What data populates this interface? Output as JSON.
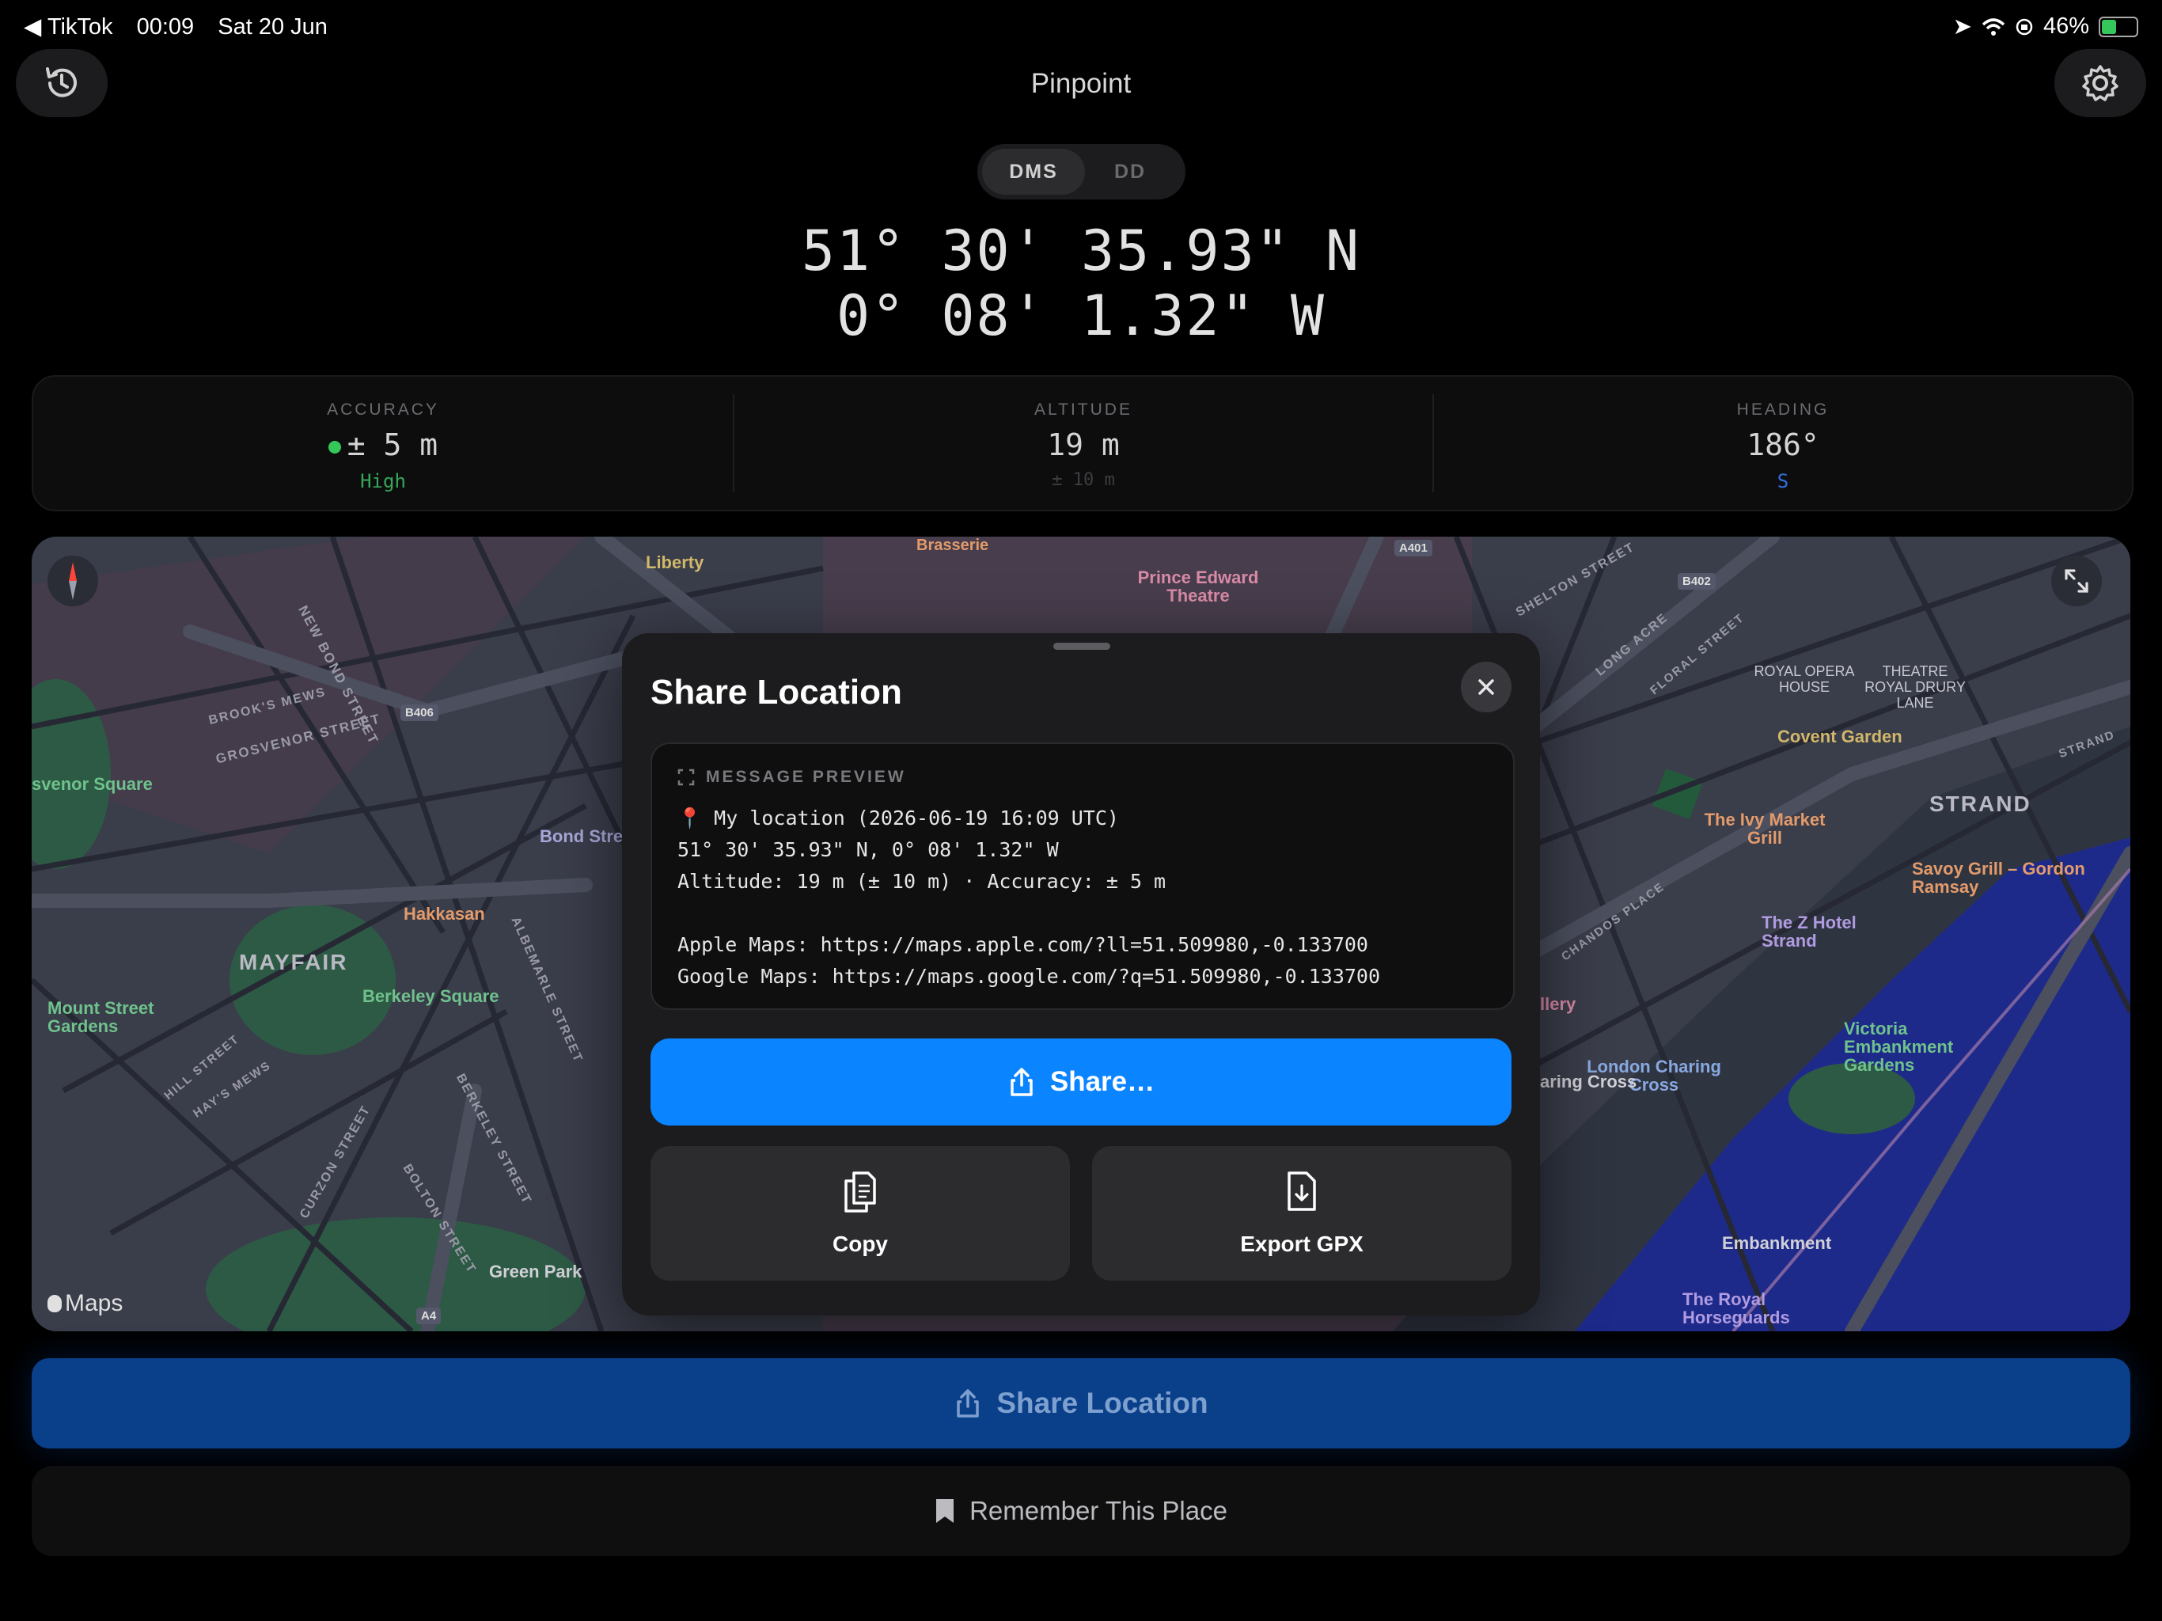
{
  "status_bar": {
    "back_app": "◀ TikTok",
    "time": "00:09",
    "date": "Sat 20 Jun",
    "battery": "46%",
    "battery_level": 0.46
  },
  "header": {
    "title": "Pinpoint"
  },
  "format_toggle": {
    "options": [
      "DMS",
      "DD"
    ],
    "selected": "DMS"
  },
  "coordinates": {
    "lat": "51° 30' 35.93\" N",
    "lon": "0° 08' 1.32\" W"
  },
  "stats": {
    "accuracy": {
      "label": "ACCURACY",
      "value": "± 5 m",
      "sub": "High",
      "color": "#35c759"
    },
    "altitude": {
      "label": "ALTITUDE",
      "value": "19 m",
      "sub": "± 10 m"
    },
    "heading": {
      "label": "HEADING",
      "value": "186°",
      "sub": "S",
      "color": "#2f6fe0"
    }
  },
  "map": {
    "attribution": "Maps",
    "labels": {
      "mayfair": "MAYFAIR",
      "strand": "STRAND",
      "covent_garden": "Covent Garden",
      "berkeley_square": "Berkeley Square",
      "hakkasan": "Hakkasan",
      "green_park": "Green Park",
      "liberty": "Liberty",
      "prince_edward": "Prince Edward Theatre",
      "bond_street": "Bond Stre",
      "grosvenor_square": "svenor Square",
      "mount_street": "Mount Street Gardens",
      "royal_opera": "ROYAL OPERA HOUSE",
      "theatre_royal": "THEATRE ROYAL DRURY LANE",
      "ivy": "The Ivy Market Grill",
      "savoy": "Savoy Grill – Gordon Ramsay",
      "z_hotel": "The Z Hotel Strand",
      "victoria_embankment": "Victoria Embankment Gardens",
      "charing_cross_station": "London Charing Cross",
      "charing_cross": "aring Cross",
      "embankment": "Embankment",
      "horseguards": "The Royal Horseguards",
      "brasserie": "Brasserie",
      "gallery": "llery",
      "b406": "B406",
      "b402": "B402",
      "a401": "A401",
      "a4": "A4",
      "grosvenor_street": "GROSVENOR STREET",
      "new_bond_street": "NEW BOND STREET",
      "brooks_mews": "BROOK'S MEWS",
      "albemarle_street": "ALBEMARLE STREET",
      "berkeley_street": "BERKELEY STREET",
      "curzon_street": "CURZON STREET",
      "bolton_street": "BOLTON STREET",
      "hill_street": "HILL STREET",
      "hays_mews": "HAY'S MEWS",
      "shelton_street": "SHELTON STREET",
      "long_acre": "LONG ACRE",
      "floral_street": "FLORAL STREET",
      "chandos_place": "CHANDOS PLACE",
      "strand_street": "STRAND"
    }
  },
  "share_sheet": {
    "title": "Share Location",
    "preview_label": "MESSAGE PREVIEW",
    "message": "📍 My location (2026-06-19 16:09 UTC)\n51° 30' 35.93\" N, 0° 08' 1.32\" W\nAltitude: 19 m (± 10 m) · Accuracy: ± 5 m\n\nApple Maps: https://maps.apple.com/?ll=51.509980,-0.133700\nGoogle Maps: https://maps.google.com/?q=51.509980,-0.133700",
    "share_label": "Share…",
    "copy_label": "Copy",
    "export_label": "Export GPX"
  },
  "actions": {
    "share_location": "Share Location",
    "remember_place": "Remember This Place"
  },
  "colors": {
    "accent": "#0a84ff",
    "map_bg": "#3a3d4a",
    "park": "#2d5a45",
    "water": "#1e2a8a"
  }
}
